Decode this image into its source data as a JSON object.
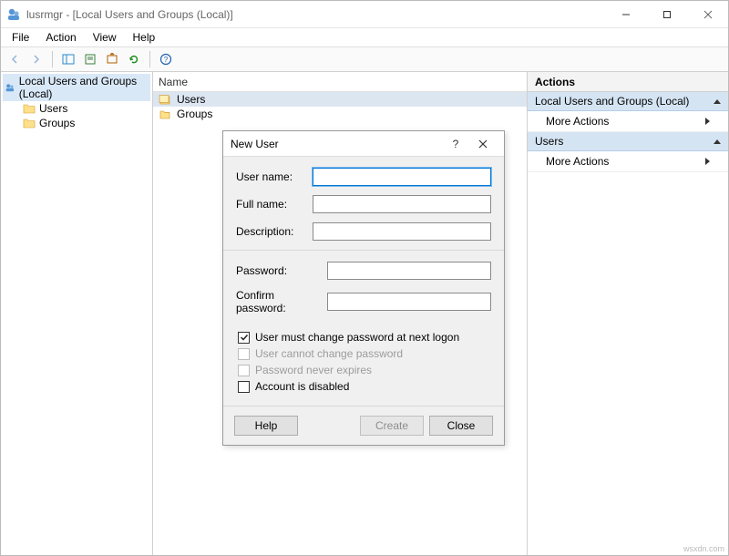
{
  "window": {
    "title": "lusrmgr - [Local Users and Groups (Local)]"
  },
  "menubar": {
    "items": [
      "File",
      "Action",
      "View",
      "Help"
    ]
  },
  "tree": {
    "root": "Local Users and Groups (Local)",
    "children": [
      "Users",
      "Groups"
    ]
  },
  "list": {
    "column": "Name",
    "items": [
      "Users",
      "Groups"
    ],
    "selected_index": 0
  },
  "actions": {
    "header": "Actions",
    "sections": [
      {
        "title": "Local Users and Groups (Local)",
        "entries": [
          "More Actions"
        ]
      },
      {
        "title": "Users",
        "entries": [
          "More Actions"
        ]
      }
    ]
  },
  "dialog": {
    "title": "New User",
    "fields": {
      "username_label": "User name:",
      "username_value": "",
      "fullname_label": "Full name:",
      "fullname_value": "",
      "description_label": "Description:",
      "description_value": "",
      "password_label": "Password:",
      "password_value": "",
      "confirm_label": "Confirm password:",
      "confirm_value": ""
    },
    "checkboxes": {
      "must_change": {
        "label": "User must change password at next logon",
        "checked": true,
        "enabled": true
      },
      "cannot_change": {
        "label": "User cannot change password",
        "checked": false,
        "enabled": false
      },
      "never_expires": {
        "label": "Password never expires",
        "checked": false,
        "enabled": false
      },
      "disabled_acct": {
        "label": "Account is disabled",
        "checked": false,
        "enabled": true
      }
    },
    "buttons": {
      "help": "Help",
      "create": "Create",
      "close": "Close"
    }
  },
  "watermark": "wsxdn.com"
}
